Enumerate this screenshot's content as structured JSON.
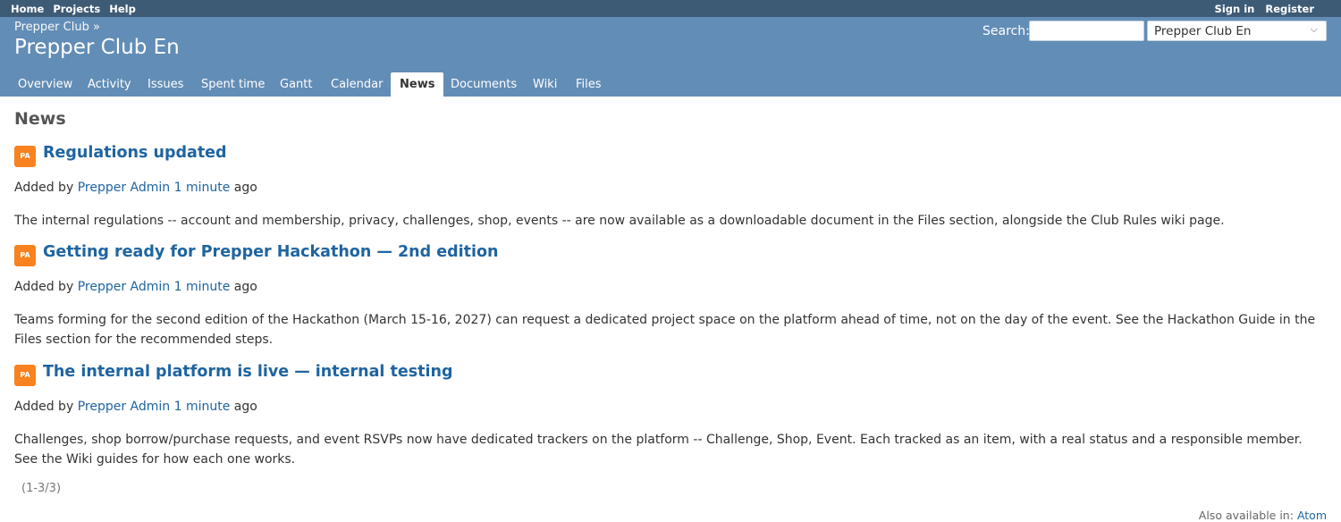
{
  "top_menu": {
    "left": [
      "Home",
      "Projects",
      "Help"
    ],
    "right": [
      "Sign in",
      "Register"
    ]
  },
  "header": {
    "parent": "Prepper Club »",
    "title": "Prepper Club En",
    "search_label": "Search:",
    "search_value": "",
    "project_select": "Prepper Club En"
  },
  "tabs": [
    "Overview",
    "Activity",
    "Issues",
    "Spent time",
    "Gantt",
    "Calendar",
    "News",
    "Documents",
    "Wiki",
    "Files"
  ],
  "selected_tab": "News",
  "page_title": "News",
  "news": [
    {
      "avatar": "PA",
      "title": "Regulations updated",
      "added_by": "Added by",
      "author": "Prepper Admin",
      "time": "1 minute",
      "ago": "ago",
      "summary": "The internal regulations -- account and membership, privacy, challenges, shop, events -- are now available as a downloadable document in the Files section, alongside the Club Rules wiki page."
    },
    {
      "avatar": "PA",
      "title": "Getting ready for Prepper Hackathon — 2nd edition",
      "added_by": "Added by",
      "author": "Prepper Admin",
      "time": "1 minute",
      "ago": "ago",
      "summary": "Teams forming for the second edition of the Hackathon (March 15-16, 2027) can request a dedicated project space on the platform ahead of time, not on the day of the event. See the Hackathon Guide in the Files section for the recommended steps."
    },
    {
      "avatar": "PA",
      "title": "The internal platform is live — internal testing",
      "added_by": "Added by",
      "author": "Prepper Admin",
      "time": "1 minute",
      "ago": "ago",
      "summary": "Challenges, shop borrow/purchase requests, and event RSVPs now have dedicated trackers on the platform -- Challenge, Shop, Event. Each tracked as an item, with a real status and a responsible member. See the Wiki guides for how each one works."
    }
  ],
  "pagination": "(1-3/3)",
  "also_available": {
    "label": "Also available in:",
    "link": "Atom"
  },
  "colors": {
    "top_bar": "#3e5b76",
    "header": "#628db6",
    "link": "#1f64a0",
    "avatar": "#f7821f"
  }
}
